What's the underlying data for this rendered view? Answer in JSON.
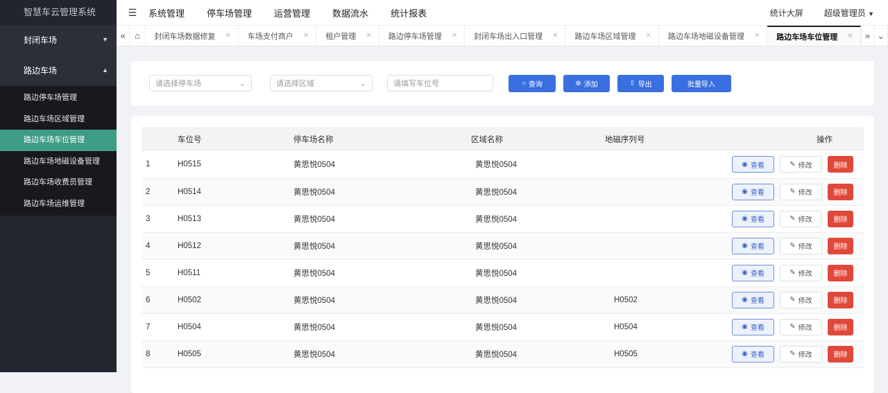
{
  "app_title": "智慧车云管理系统",
  "sidebar": {
    "groups": [
      {
        "label": "封闭车场",
        "expanded": false
      },
      {
        "label": "路边车场",
        "expanded": true
      }
    ],
    "items": [
      "路边停车场管理",
      "路边车场区域管理",
      "路边车场车位管理",
      "路边车场地磁设备管理",
      "路边车场收费员管理",
      "路边车场运维管理"
    ],
    "active": 2
  },
  "header": {
    "nav": [
      "系统管理",
      "停车场管理",
      "运营管理",
      "数据流水",
      "统计报表"
    ],
    "screen": "统计大屏",
    "user": "超级管理员"
  },
  "tabs": [
    "封闭车场数据修复",
    "车场支付商户",
    "租户管理",
    "路边停车场管理",
    "封闭车场出入口管理",
    "路边车场区域管理",
    "路边车场地磁设备管理",
    "路边车场车位管理"
  ],
  "search": {
    "parking_placeholder": "请选择停车场",
    "area_placeholder": "请选择区域",
    "space_placeholder": "请填写车位号",
    "query": "查询",
    "add": "添加",
    "export": "导出",
    "import": "批量导入"
  },
  "table": {
    "headers": [
      "车位号",
      "停车场名称",
      "区域名称",
      "地磁序列号",
      "操作"
    ],
    "rows": [
      [
        "1",
        "H0515",
        "黄思悦0504",
        "黄思悦0504",
        ""
      ],
      [
        "2",
        "H0514",
        "黄思悦0504",
        "黄思悦0504",
        ""
      ],
      [
        "3",
        "H0513",
        "黄思悦0504",
        "黄思悦0504",
        ""
      ],
      [
        "4",
        "H0512",
        "黄思悦0504",
        "黄思悦0504",
        ""
      ],
      [
        "5",
        "H0511",
        "黄思悦0504",
        "黄思悦0504",
        ""
      ],
      [
        "6",
        "H0502",
        "黄思悦0504",
        "黄思悦0504",
        "H0502"
      ],
      [
        "7",
        "H0504",
        "黄思悦0504",
        "黄思悦0504",
        "H0504"
      ],
      [
        "8",
        "H0505",
        "黄思悦0504",
        "黄思悦0504",
        "H0505"
      ]
    ],
    "view": "查看",
    "edit": "修改",
    "delete": "删除"
  }
}
